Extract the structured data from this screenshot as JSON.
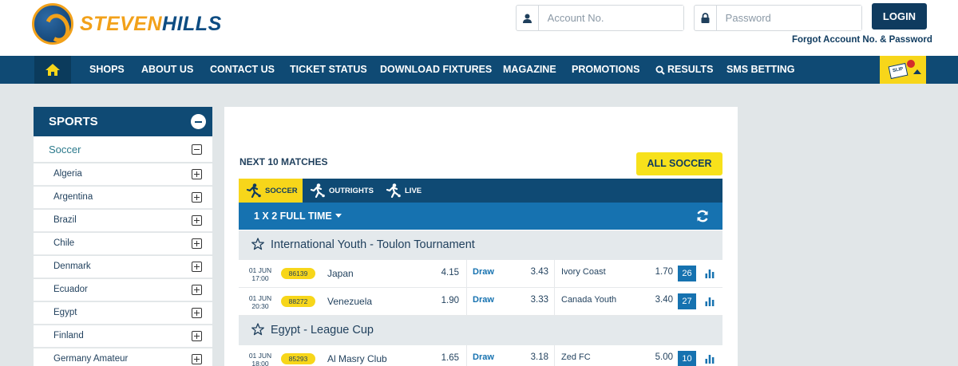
{
  "brand": {
    "part1": "STEVEN",
    "part2": "HILLS"
  },
  "login": {
    "account_placeholder": "Account No.",
    "password_placeholder": "Password",
    "login_label": "LOGIN",
    "forgot_label": "Forgot Account No. & Password"
  },
  "nav": {
    "items": [
      "SHOPS",
      "ABOUT US",
      "CONTACT US",
      "TICKET STATUS",
      "DOWNLOAD FIXTURES",
      "MAGAZINE",
      "PROMOTIONS",
      "RESULTS",
      "SMS BETTING"
    ],
    "slip_label": "SLIP"
  },
  "sidebar": {
    "title": "SPORTS",
    "sport": "Soccer",
    "countries": [
      "Algeria",
      "Argentina",
      "Brazil",
      "Chile",
      "Denmark",
      "Ecuador",
      "Egypt",
      "Finland",
      "Germany Amateur"
    ]
  },
  "main": {
    "next_title": "NEXT 10 MATCHES",
    "all_soccer": "ALL SOCCER",
    "tabs": [
      "SOCCER",
      "OUTRIGHTS",
      "LIVE"
    ],
    "market": "1 X 2 FULL TIME",
    "leagues": [
      {
        "name": "International Youth - Toulon Tournament",
        "matches": [
          {
            "date": "01 JUN",
            "time": "17:00",
            "code": "86139",
            "home": "Japan",
            "home_odd": "4.15",
            "draw": "Draw",
            "draw_odd": "3.43",
            "away": "Ivory Coast",
            "away_odd": "1.70",
            "more": "26"
          },
          {
            "date": "01 JUN",
            "time": "20:30",
            "code": "88272",
            "home": "Venezuela",
            "home_odd": "1.90",
            "draw": "Draw",
            "draw_odd": "3.33",
            "away": "Canada Youth",
            "away_odd": "3.40",
            "more": "27"
          }
        ]
      },
      {
        "name": "Egypt - League Cup",
        "matches": [
          {
            "date": "01 JUN",
            "time": "18:00",
            "code": "85293",
            "home": "Al Masry Club",
            "home_odd": "1.65",
            "draw": "Draw",
            "draw_odd": "3.18",
            "away": "Zed FC",
            "away_odd": "5.00",
            "more": "10"
          }
        ]
      }
    ]
  },
  "colors": {
    "primary": "#0f4a74",
    "accent": "#f7d61a",
    "link": "#1672b0",
    "brand_orange": "#f2a11a"
  },
  "icons": [
    "home-icon",
    "user-icon",
    "lock-icon",
    "search-icon",
    "refresh-icon",
    "star-icon",
    "stats-icon",
    "soccer-player-icon"
  ]
}
